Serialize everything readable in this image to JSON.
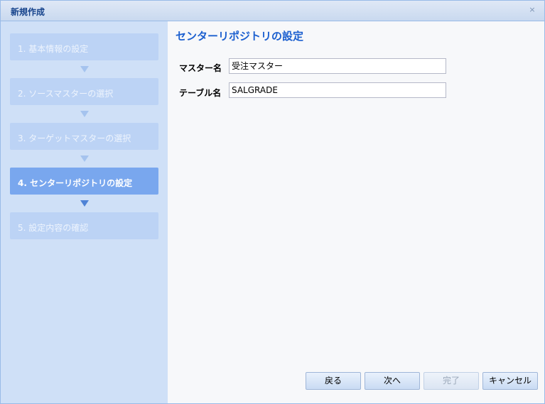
{
  "window": {
    "title": "新規作成",
    "close_label": "×"
  },
  "sidebar": {
    "steps": [
      {
        "label": "1. 基本情報の設定"
      },
      {
        "label": "2. ソースマスターの選択"
      },
      {
        "label": "3. ターゲットマスターの選択"
      },
      {
        "label": "4. センターリポジトリの設定"
      },
      {
        "label": "5. 設定内容の確認"
      }
    ],
    "active_step_number": 4
  },
  "main": {
    "heading": "センターリポジトリの設定",
    "fields": {
      "master_name": {
        "label": "マスター名",
        "value": "受注マスター"
      },
      "table_name": {
        "label": "テーブル名",
        "value": "SALGRADE"
      }
    }
  },
  "buttons": {
    "back": "戻る",
    "next": "次へ",
    "finish": "完了",
    "cancel": "キャンセル"
  },
  "colors": {
    "heading": "#1b5fcf",
    "active_step": "#79a7ee",
    "inactive_step": "#bcd3f5",
    "sidebar_bg": "#cfe0f7"
  }
}
